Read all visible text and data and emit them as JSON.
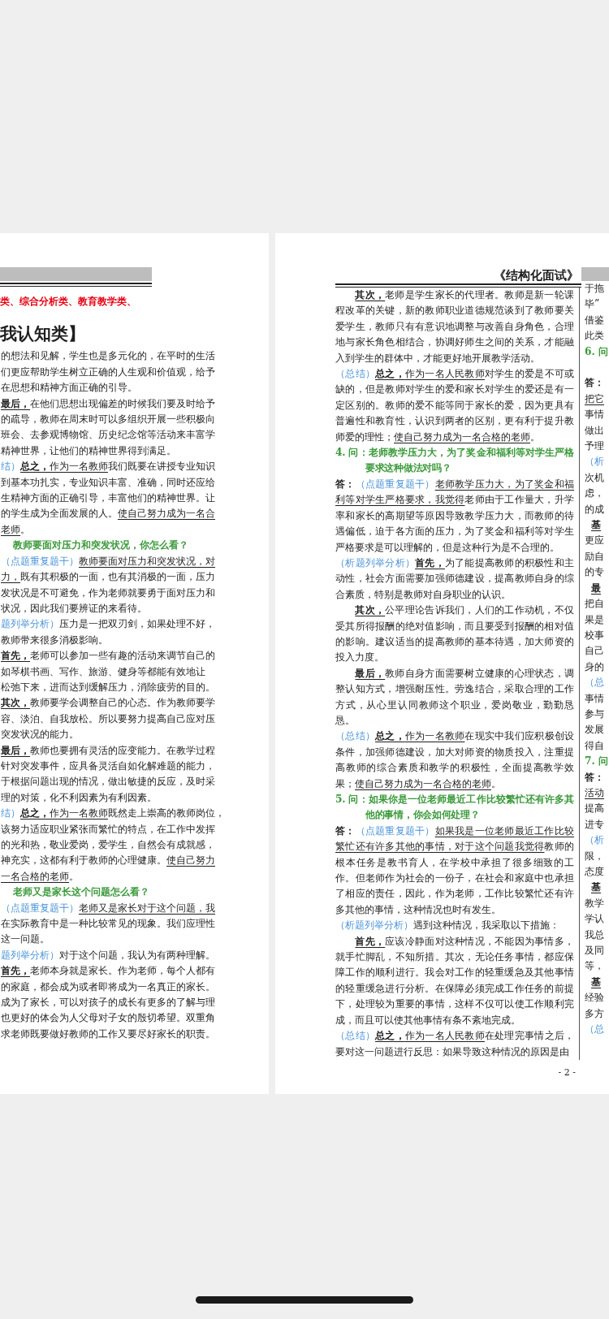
{
  "left_page": {
    "subtitle": "类、综合分析类、教育教学类、",
    "heading": "我认知类】",
    "lines": [
      {
        "kind": "line",
        "parts": [
          {
            "kind": "plain",
            "text": "的想法和见解，学生也是多元化的，在平时的生活"
          }
        ]
      },
      {
        "kind": "line",
        "parts": [
          {
            "kind": "plain",
            "text": "们更应帮助学生树立正确的人生观和价值观，给予"
          }
        ]
      },
      {
        "kind": "line",
        "parts": [
          {
            "kind": "plain",
            "text": "在思想和精神方面正确的引导。"
          }
        ]
      },
      {
        "kind": "line",
        "parts": [
          {
            "kind": "lead",
            "text": "最后，"
          },
          {
            "kind": "plain",
            "text": "在他们思想出现偏差的时候我们要及时给予"
          }
        ]
      },
      {
        "kind": "line",
        "parts": [
          {
            "kind": "plain",
            "text": "的疏导，教师在周末时可以多组织开展一些积极向"
          }
        ]
      },
      {
        "kind": "line",
        "parts": [
          {
            "kind": "plain",
            "text": "班会、去参观博物馆、历史纪念馆等活动来丰富学"
          }
        ]
      },
      {
        "kind": "line",
        "parts": [
          {
            "kind": "plain",
            "text": "精神世界，让他们的精神世界得到满足。"
          }
        ]
      },
      {
        "kind": "line",
        "parts": [
          {
            "kind": "label",
            "text": "结）"
          },
          {
            "kind": "lead",
            "text": "总之，"
          },
          {
            "kind": "key",
            "text": "作为一名教师"
          },
          {
            "kind": "plain",
            "text": "我们既要在讲授专业知识"
          }
        ]
      },
      {
        "kind": "line",
        "parts": [
          {
            "kind": "plain",
            "text": "到基本功扎实，专业知识丰富、准确，同时还应给"
          }
        ]
      },
      {
        "kind": "line",
        "parts": [
          {
            "kind": "plain",
            "text": "生精神方面的正确引导，丰富他们的精神世界。让"
          }
        ]
      },
      {
        "kind": "line",
        "parts": [
          {
            "kind": "plain",
            "text": "的学生成为全面发展的人。"
          },
          {
            "kind": "key",
            "text": "使自己努力成为一名合"
          }
        ]
      },
      {
        "kind": "line",
        "parts": [
          {
            "kind": "key",
            "text": "老师"
          },
          {
            "kind": "plain",
            "text": "。"
          }
        ]
      },
      {
        "kind": "question",
        "parts": [
          {
            "kind": "plain",
            "text": "教师要面对压力和突发状况，你怎么看？"
          }
        ]
      },
      {
        "kind": "line",
        "parts": [
          {
            "kind": "label",
            "text": "（点题重复题干）"
          },
          {
            "kind": "key",
            "text": "教师要面对压力和突发状况，对"
          }
        ]
      },
      {
        "kind": "line",
        "parts": [
          {
            "kind": "key",
            "text": "力，"
          },
          {
            "kind": "plain",
            "text": "既有其积极的一面，也有其消极的一面，压力"
          }
        ]
      },
      {
        "kind": "line",
        "parts": [
          {
            "kind": "plain",
            "text": "发状况是不可避免，作为老师就要勇于面对压力和"
          }
        ]
      },
      {
        "kind": "line",
        "parts": [
          {
            "kind": "plain",
            "text": "状况，因此我们要辨证的来看待。"
          }
        ]
      },
      {
        "kind": "line",
        "parts": [
          {
            "kind": "label",
            "text": "题列举分析）"
          },
          {
            "kind": "plain",
            "text": "压力是一把双刃剑，如果处理不好，"
          }
        ]
      },
      {
        "kind": "line",
        "parts": [
          {
            "kind": "plain",
            "text": "教师带来很多消极影响。"
          }
        ]
      },
      {
        "kind": "line",
        "parts": [
          {
            "kind": "lead",
            "text": "首先，"
          },
          {
            "kind": "plain",
            "text": "老师可以参加一些有趣的活动来调节自己的"
          }
        ]
      },
      {
        "kind": "line",
        "parts": [
          {
            "kind": "plain",
            "text": "如琴棋书画、写作、旅游、健身等都能有效地让"
          }
        ]
      },
      {
        "kind": "line",
        "parts": [
          {
            "kind": "plain",
            "text": "松弛下来，进而达到缓解压力，消除疲劳的目的。"
          }
        ]
      },
      {
        "kind": "line",
        "parts": [
          {
            "kind": "lead",
            "text": "其次，"
          },
          {
            "kind": "plain",
            "text": "教师要学会调整自己的心态。作为教师要学"
          }
        ]
      },
      {
        "kind": "line",
        "parts": [
          {
            "kind": "plain",
            "text": "容、淡泊、自我放松。所以要努力提高自己应对压"
          }
        ]
      },
      {
        "kind": "line",
        "parts": [
          {
            "kind": "plain",
            "text": "突发状况的能力。"
          }
        ]
      },
      {
        "kind": "line",
        "parts": [
          {
            "kind": "lead",
            "text": "最后，"
          },
          {
            "kind": "plain",
            "text": "教师也要拥有灵活的应变能力。在教学过程"
          }
        ]
      },
      {
        "kind": "line",
        "parts": [
          {
            "kind": "plain",
            "text": "针对突发事件，应具备灵活自如化解难题的能力，"
          }
        ]
      },
      {
        "kind": "line",
        "parts": [
          {
            "kind": "plain",
            "text": "于根据问题出现的情况，做出敏捷的反应，及时采"
          }
        ]
      },
      {
        "kind": "line",
        "parts": [
          {
            "kind": "plain",
            "text": "理的对策，化不利因素为有利因素。"
          }
        ]
      },
      {
        "kind": "line",
        "parts": [
          {
            "kind": "label",
            "text": "结）"
          },
          {
            "kind": "lead",
            "text": "总之，"
          },
          {
            "kind": "key",
            "text": "作为一名教师"
          },
          {
            "kind": "plain",
            "text": "既然走上崇高的教师岗位，"
          }
        ]
      },
      {
        "kind": "line",
        "parts": [
          {
            "kind": "plain",
            "text": "该努力适应职业紧张而繁忙的特点，在工作中发挥"
          }
        ]
      },
      {
        "kind": "line",
        "parts": [
          {
            "kind": "plain",
            "text": "的光和热，敬业爱岗，爱学生，自然会有成就感，"
          }
        ]
      },
      {
        "kind": "line",
        "parts": [
          {
            "kind": "plain",
            "text": "神充实，这都有利于教师的心理健康。"
          },
          {
            "kind": "key",
            "text": "使自己努力"
          }
        ]
      },
      {
        "kind": "line",
        "parts": [
          {
            "kind": "key",
            "text": "一名合格的老师"
          },
          {
            "kind": "plain",
            "text": "。"
          }
        ]
      },
      {
        "kind": "question",
        "parts": [
          {
            "kind": "plain",
            "text": "老师又是家长这个问题怎么看？"
          }
        ]
      },
      {
        "kind": "line",
        "parts": [
          {
            "kind": "label",
            "text": "（点题重复题干）"
          },
          {
            "kind": "key",
            "text": "老师又是家长对于这个问题，我"
          }
        ]
      },
      {
        "kind": "line",
        "parts": [
          {
            "kind": "plain",
            "text": "在实际教育中是一种比较常见的现象。我们应理性"
          }
        ]
      },
      {
        "kind": "line",
        "parts": [
          {
            "kind": "plain",
            "text": "这一问题。"
          }
        ]
      },
      {
        "kind": "line",
        "parts": [
          {
            "kind": "label",
            "text": "题列举分析）"
          },
          {
            "kind": "plain",
            "text": "对于这个问题，我认为有两种理解。"
          }
        ]
      },
      {
        "kind": "line",
        "parts": [
          {
            "kind": "lead",
            "text": "首先，"
          },
          {
            "kind": "plain",
            "text": "老师本身就是家长。作为老师，每个人都有"
          }
        ]
      },
      {
        "kind": "line",
        "parts": [
          {
            "kind": "plain",
            "text": "的家庭，都会成为或者即将成为一名真正的家长。"
          }
        ]
      },
      {
        "kind": "line",
        "parts": [
          {
            "kind": "plain",
            "text": "成为了家长，可以对孩子的成长有更多的了解与理"
          }
        ]
      },
      {
        "kind": "line",
        "parts": [
          {
            "kind": "plain",
            "text": "也更好的体会为人父母对子女的殷切希望。双重角"
          }
        ]
      },
      {
        "kind": "line",
        "parts": [
          {
            "kind": "plain",
            "text": "求老师既要做好教师的工作又要尽好家长的职责。"
          }
        ]
      }
    ]
  },
  "center_page": {
    "header": "《结构化面试》",
    "page_number": "- 2 -",
    "paragraphs": [
      {
        "kind": "indent",
        "parts": [
          {
            "kind": "lead",
            "text": "其次，"
          },
          {
            "kind": "plain",
            "text": "老师是学生家长的代理者。教师是新一轮课程改革的关键，新的教师职业道德规范谈到了教师要关爱学生，教师只有有意识地调整与改善自身角色，合理地与家长角色相结合，协调好师生之间的关系，才能融入到学生的群体中，才能更好地开展教学活动。"
          }
        ]
      },
      {
        "kind": "body",
        "parts": [
          {
            "kind": "label",
            "text": "（总结）"
          },
          {
            "kind": "lead",
            "text": "总之，"
          },
          {
            "kind": "key",
            "text": "作为一名人民教师"
          },
          {
            "kind": "plain",
            "text": "对学生的爱是不可或缺的，但是教师对学生的爱和家长对学生的爱还是有一定区别的。教师的爱不能等同于家长的爱，因为更具有普遍性和教育性，认识到两者的区别，更有利于提升教师爱的理性；"
          },
          {
            "kind": "key",
            "text": "使自己努力成为一名合格的老师"
          },
          {
            "kind": "plain",
            "text": "。"
          }
        ]
      },
      {
        "kind": "question",
        "parts": [
          {
            "kind": "plain",
            "text": "4. 问：老师教学压力大，为了奖金和福利等对学生严格要求这种做法对吗？"
          }
        ]
      },
      {
        "kind": "body",
        "parts": [
          {
            "kind": "answer",
            "text": "答："
          },
          {
            "kind": "label",
            "text": "（点题重复题干）"
          },
          {
            "kind": "key",
            "text": "老师教学压力大，为了奖金和福利等对学生严格要求，我觉得"
          },
          {
            "kind": "plain",
            "text": "老师由于工作量大，升学率和家长的高期望等原因导致教学压力大，而教师的待遇偏低，迫于各方面的压力，为了奖金和福利等对学生严格要求是可以理解的，但是这种行为是不合理的。"
          }
        ]
      },
      {
        "kind": "body",
        "parts": [
          {
            "kind": "label",
            "text": "（析题列举分析）"
          },
          {
            "kind": "lead",
            "text": "首先，"
          },
          {
            "kind": "plain",
            "text": "为了能提高教师的积极性和主动性，社会方面需要加强师德建设，提高教师自身的综合素质，特别是教师对自身职业的认识。"
          }
        ]
      },
      {
        "kind": "indent",
        "parts": [
          {
            "kind": "lead",
            "text": "其次，"
          },
          {
            "kind": "plain",
            "text": "公平理论告诉我们，人们的工作动机，不仅受其所得报酬的绝对值影响，而且要受到报酬的相对值的影响。建议适当的提高教师的基本待遇，加大师资的投入力度。"
          }
        ]
      },
      {
        "kind": "indent",
        "parts": [
          {
            "kind": "lead",
            "text": "最后，"
          },
          {
            "kind": "plain",
            "text": "教师自身方面需要树立健康的心理状态，调整认知方式，增强耐压性。劳逸结合，采取合理的工作方式，从心里认同教师这个职业，爱岗敬业，勤勤恳恳。"
          }
        ]
      },
      {
        "kind": "body",
        "parts": [
          {
            "kind": "label",
            "text": "（总结）"
          },
          {
            "kind": "lead",
            "text": "总之，"
          },
          {
            "kind": "key",
            "text": "作为一名教师"
          },
          {
            "kind": "plain",
            "text": "在现实中我们应积极创设条件，加强师德建设，加大对师资的物质投入，注重提高教师的综合素质和教学的积极性，全面提高教学效果；"
          },
          {
            "kind": "key",
            "text": "使自己努力成为一名合格的老师"
          },
          {
            "kind": "plain",
            "text": "。"
          }
        ]
      },
      {
        "kind": "question",
        "parts": [
          {
            "kind": "plain",
            "text": "5. 问：如果你是一位老师最近工作比较繁忙还有许多其他的事情，你会如何处理？"
          }
        ]
      },
      {
        "kind": "body",
        "parts": [
          {
            "kind": "answer",
            "text": "答："
          },
          {
            "kind": "label",
            "text": "（点题重复题干）"
          },
          {
            "kind": "key",
            "text": "如果我是一位老师最近工作比较繁忙还有许多其他的事情，对于这个问题我觉得"
          },
          {
            "kind": "plain",
            "text": "教师的根本任务是教书育人，在学校中承担了很多细致的工作。但老师作为社会的一份子，在社会和家庭中也承担了相应的责任，因此，作为老师，工作比较繁忙还有许多其他的事情，这种情况也时有发生。"
          }
        ]
      },
      {
        "kind": "body",
        "parts": [
          {
            "kind": "label",
            "text": "（析题列举分析）"
          },
          {
            "kind": "plain",
            "text": "遇到这种情况，我采取以下措施："
          }
        ]
      },
      {
        "kind": "indent",
        "parts": [
          {
            "kind": "lead",
            "text": "首先，"
          },
          {
            "kind": "plain",
            "text": "应该冷静面对这种情况，不能因为事情多，就手忙脚乱，不知所措。其次，无论任务事情，都应保障工作的顺利进行。我会对工作的轻重缓急及其他事情的轻重缓急进行分析。在保障必须完成工作任务的前提下，处理较为重要的事情，这样不仅可以使工作顺利完成，而且可以使其他事情有条不紊地完成。"
          }
        ]
      },
      {
        "kind": "body",
        "parts": [
          {
            "kind": "label",
            "text": "（总结）"
          },
          {
            "kind": "lead",
            "text": "总之，"
          },
          {
            "kind": "key",
            "text": "作为一名人民教师"
          },
          {
            "kind": "plain",
            "text": "在处理完事情之后，要对这一问题进行反思：如果导致这种情况的原因是由"
          }
        ]
      }
    ]
  },
  "right_page": {
    "lines": [
      {
        "kind": "line",
        "parts": [
          {
            "kind": "plain",
            "text": "于拖"
          }
        ]
      },
      {
        "kind": "line",
        "parts": [
          {
            "kind": "plain",
            "text": "毕”"
          }
        ]
      },
      {
        "kind": "line",
        "parts": [
          {
            "kind": "plain",
            "text": "借鉴"
          }
        ]
      },
      {
        "kind": "line",
        "parts": [
          {
            "kind": "plain",
            "text": "此类"
          }
        ]
      },
      {
        "kind": "question-long",
        "parts": [
          {
            "kind": "plain",
            "text": "6. 问"
          }
        ]
      },
      {
        "kind": "line",
        "parts": [
          {
            "kind": "answer",
            "text": "答："
          }
        ]
      },
      {
        "kind": "line",
        "parts": [
          {
            "kind": "key",
            "text": "把它"
          }
        ]
      },
      {
        "kind": "line",
        "parts": [
          {
            "kind": "plain",
            "text": "事情"
          }
        ]
      },
      {
        "kind": "line",
        "parts": [
          {
            "kind": "plain",
            "text": "做出"
          }
        ]
      },
      {
        "kind": "line",
        "parts": [
          {
            "kind": "plain",
            "text": "予理"
          }
        ]
      },
      {
        "kind": "line",
        "parts": [
          {
            "kind": "label",
            "text": "（析"
          }
        ]
      },
      {
        "kind": "line",
        "parts": [
          {
            "kind": "plain",
            "text": "次机"
          }
        ]
      },
      {
        "kind": "line",
        "parts": [
          {
            "kind": "plain",
            "text": "虑，"
          }
        ]
      },
      {
        "kind": "line",
        "parts": [
          {
            "kind": "plain",
            "text": "的成"
          }
        ]
      },
      {
        "kind": "indent",
        "parts": [
          {
            "kind": "lead",
            "text": "基"
          }
        ]
      },
      {
        "kind": "line",
        "parts": [
          {
            "kind": "plain",
            "text": "更应"
          }
        ]
      },
      {
        "kind": "line",
        "parts": [
          {
            "kind": "plain",
            "text": "励自"
          }
        ]
      },
      {
        "kind": "line",
        "parts": [
          {
            "kind": "plain",
            "text": "的专"
          }
        ]
      },
      {
        "kind": "indent",
        "parts": [
          {
            "kind": "lead",
            "text": "最"
          }
        ]
      },
      {
        "kind": "line",
        "parts": [
          {
            "kind": "plain",
            "text": "把自"
          }
        ]
      },
      {
        "kind": "line",
        "parts": [
          {
            "kind": "plain",
            "text": "果是"
          }
        ]
      },
      {
        "kind": "line",
        "parts": [
          {
            "kind": "plain",
            "text": "校事"
          }
        ]
      },
      {
        "kind": "line",
        "parts": [
          {
            "kind": "plain",
            "text": "自己"
          }
        ]
      },
      {
        "kind": "line",
        "parts": [
          {
            "kind": "plain",
            "text": "身的"
          }
        ]
      },
      {
        "kind": "line",
        "parts": [
          {
            "kind": "label",
            "text": "（总"
          }
        ]
      },
      {
        "kind": "line",
        "parts": [
          {
            "kind": "plain",
            "text": "事情"
          }
        ]
      },
      {
        "kind": "line",
        "parts": [
          {
            "kind": "plain",
            "text": "参与"
          }
        ]
      },
      {
        "kind": "line",
        "parts": [
          {
            "kind": "plain",
            "text": "发展"
          }
        ]
      },
      {
        "kind": "line",
        "parts": [
          {
            "kind": "plain",
            "text": "得自"
          }
        ]
      },
      {
        "kind": "question",
        "parts": [
          {
            "kind": "plain",
            "text": "7. 问"
          }
        ]
      },
      {
        "kind": "line",
        "parts": [
          {
            "kind": "answer",
            "text": "答："
          }
        ]
      },
      {
        "kind": "line",
        "parts": [
          {
            "kind": "key",
            "text": "活动"
          }
        ]
      },
      {
        "kind": "line",
        "parts": [
          {
            "kind": "plain",
            "text": "提高"
          }
        ]
      },
      {
        "kind": "line",
        "parts": [
          {
            "kind": "plain",
            "text": "进专"
          }
        ]
      },
      {
        "kind": "line",
        "parts": [
          {
            "kind": "label",
            "text": "（析"
          }
        ]
      },
      {
        "kind": "line",
        "parts": [
          {
            "kind": "plain",
            "text": "限，"
          }
        ]
      },
      {
        "kind": "line",
        "parts": [
          {
            "kind": "plain",
            "text": "态度"
          }
        ]
      },
      {
        "kind": "indent",
        "parts": [
          {
            "kind": "lead",
            "text": "基"
          }
        ]
      },
      {
        "kind": "line",
        "parts": [
          {
            "kind": "plain",
            "text": "教学"
          }
        ]
      },
      {
        "kind": "line",
        "parts": [
          {
            "kind": "plain",
            "text": "学认"
          }
        ]
      },
      {
        "kind": "line",
        "parts": [
          {
            "kind": "plain",
            "text": "我总"
          }
        ]
      },
      {
        "kind": "line",
        "parts": [
          {
            "kind": "plain",
            "text": "及同"
          }
        ]
      },
      {
        "kind": "line",
        "parts": [
          {
            "kind": "plain",
            "text": "等，"
          }
        ]
      },
      {
        "kind": "indent",
        "parts": [
          {
            "kind": "lead",
            "text": "基"
          }
        ]
      },
      {
        "kind": "line",
        "parts": [
          {
            "kind": "plain",
            "text": "经验"
          }
        ]
      },
      {
        "kind": "line",
        "parts": [
          {
            "kind": "plain",
            "text": "多方"
          }
        ]
      },
      {
        "kind": "line",
        "parts": [
          {
            "kind": "label",
            "text": "（总"
          }
        ]
      }
    ]
  }
}
